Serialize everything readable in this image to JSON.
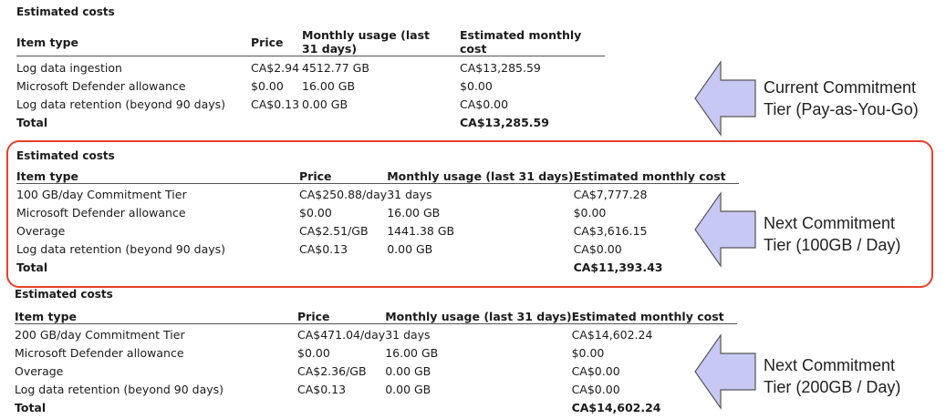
{
  "tables": [
    {
      "title": "Estimated costs",
      "headers": [
        "Item type",
        "Price",
        "Monthly usage (last 31 days)",
        "Estimated monthly cost"
      ],
      "rows": [
        [
          "Log data ingestion",
          "CA$2.94",
          "4512.77 GB",
          "CA$13,285.59"
        ],
        [
          "Microsoft Defender allowance",
          "$0.00",
          "16.00 GB",
          "$0.00"
        ],
        [
          "Log data retention (beyond 90 days)",
          "CA$0.13",
          "0.00 GB",
          "CA$0.00"
        ],
        [
          "Total",
          "",
          "",
          "CA$13,285.59"
        ]
      ],
      "callout": [
        "Current Commitment",
        "Tier (Pay-as-You-Go)"
      ]
    },
    {
      "title": "Estimated costs",
      "headers": [
        "Item type",
        "Price",
        "Monthly usage (last 31 days)",
        "Estimated monthly cost"
      ],
      "rows": [
        [
          "100 GB/day Commitment Tier",
          "CA$250.88/day",
          "31 days",
          "CA$7,777.28"
        ],
        [
          "Microsoft Defender allowance",
          "$0.00",
          "16.00 GB",
          "$0.00"
        ],
        [
          "Overage",
          "CA$2.51/GB",
          "1441.38 GB",
          "CA$3,616.15"
        ],
        [
          "Log data retention (beyond 90 days)",
          "CA$0.13",
          "0.00 GB",
          "CA$0.00"
        ],
        [
          "Total",
          "",
          "",
          "CA$11,393.43"
        ]
      ],
      "callout": [
        "Next Commitment",
        "Tier (100GB / Day)"
      ]
    },
    {
      "title": "Estimated costs",
      "headers": [
        "Item type",
        "Price",
        "Monthly usage (last 31 days)",
        "Estimated monthly cost"
      ],
      "rows": [
        [
          "200 GB/day Commitment Tier",
          "CA$471.04/day",
          "31 days",
          "CA$14,602.24"
        ],
        [
          "Microsoft Defender allowance",
          "$0.00",
          "16.00 GB",
          "$0.00"
        ],
        [
          "Overage",
          "CA$2.36/GB",
          "0.00 GB",
          "CA$0.00"
        ],
        [
          "Log data retention (beyond 90 days)",
          "CA$0.13",
          "0.00 GB",
          "CA$0.00"
        ],
        [
          "Total",
          "",
          "",
          "CA$14,602.24"
        ]
      ],
      "callout": [
        "Next Commitment",
        "Tier (200GB / Day)"
      ]
    }
  ],
  "colors": {
    "highlight": "#e8402a",
    "arrow_fill": "#c8c8f4",
    "arrow_stroke": "#555555"
  },
  "icons": [
    "left-arrow-icon"
  ]
}
